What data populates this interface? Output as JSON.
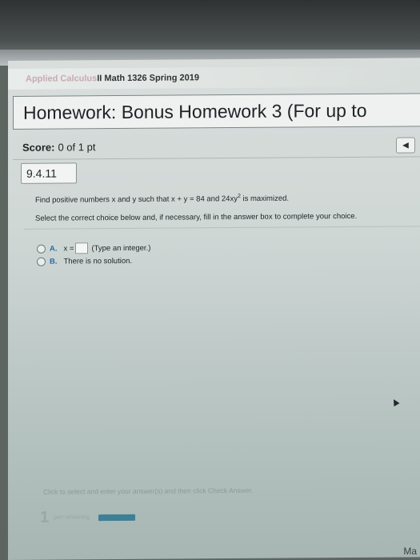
{
  "header": {
    "course_faded": "Applied Calculus",
    "course_rest": " II Math 1326 Spring 2019",
    "homework_title": "Homework: Bonus Homework 3 (For up to"
  },
  "score": {
    "label": "Score:",
    "value": "0 of 1 pt"
  },
  "nav": {
    "prev_glyph": "◀"
  },
  "question": {
    "id": "9.4.11",
    "text_before": "Find positive numbers x and y such that x + y = 84 and 24xy",
    "exponent": "2",
    "text_after": " is maximized.",
    "instruction": "Select the correct choice below and, if necessary, fill in the answer box to complete your choice."
  },
  "choices": {
    "a_letter": "A.",
    "a_prefix": "x =",
    "a_hint": "(Type an integer.)",
    "b_letter": "B.",
    "b_text": "There is no solution."
  },
  "footer": {
    "help": "Click to select and enter your answer(s) and then click Check Answer.",
    "parts_count": "1",
    "parts_label": "part remaining",
    "corner": "Ma"
  }
}
